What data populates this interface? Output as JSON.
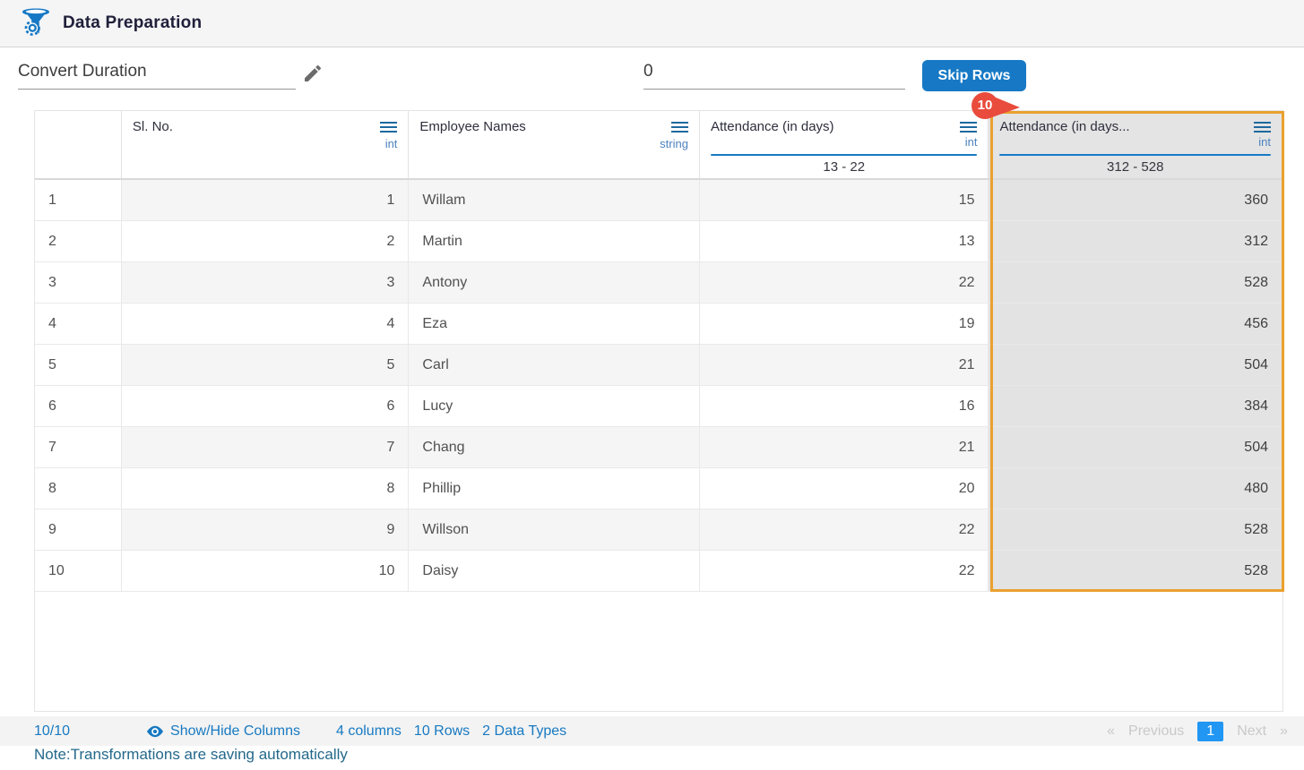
{
  "colors": {
    "accent_blue": "#1779C5",
    "link_blue": "#1779C2",
    "active_page_blue": "#2196F3",
    "highlight_orange": "#EAA12F",
    "badge_red": "#E94B3C",
    "type_label_blue": "#4D82BE",
    "note_teal": "#23688A"
  },
  "header": {
    "title": "Data Preparation",
    "logo_icon": "funnel-gear-icon"
  },
  "toolbar": {
    "transform_name": "Convert Duration",
    "edit_icon": "pencil-icon",
    "skip_rows_value": "0",
    "skip_rows_label": "Skip Rows",
    "column_badge_count": "10"
  },
  "table": {
    "columns": [
      {
        "name": "Sl. No.",
        "type": "int"
      },
      {
        "name": "Employee Names",
        "type": "string"
      },
      {
        "name": "Attendance (in days)",
        "type": "int",
        "range": "13 - 22"
      },
      {
        "name": "Attendance (in days...",
        "type": "int",
        "range": "312 - 528",
        "highlighted": true
      }
    ],
    "rows": [
      {
        "num": "1",
        "sl_no": "1",
        "employee_name": "Willam",
        "attendance1": "15",
        "attendance2": "360"
      },
      {
        "num": "2",
        "sl_no": "2",
        "employee_name": "Martin",
        "attendance1": "13",
        "attendance2": "312"
      },
      {
        "num": "3",
        "sl_no": "3",
        "employee_name": "Antony",
        "attendance1": "22",
        "attendance2": "528"
      },
      {
        "num": "4",
        "sl_no": "4",
        "employee_name": "Eza",
        "attendance1": "19",
        "attendance2": "456"
      },
      {
        "num": "5",
        "sl_no": "5",
        "employee_name": "Carl",
        "attendance1": "21",
        "attendance2": "504"
      },
      {
        "num": "6",
        "sl_no": "6",
        "employee_name": "Lucy",
        "attendance1": "16",
        "attendance2": "384"
      },
      {
        "num": "7",
        "sl_no": "7",
        "employee_name": "Chang",
        "attendance1": "21",
        "attendance2": "504"
      },
      {
        "num": "8",
        "sl_no": "8",
        "employee_name": "Phillip",
        "attendance1": "20",
        "attendance2": "480"
      },
      {
        "num": "9",
        "sl_no": "9",
        "employee_name": "Willson",
        "attendance1": "22",
        "attendance2": "528"
      },
      {
        "num": "10",
        "sl_no": "10",
        "employee_name": "Daisy",
        "attendance1": "22",
        "attendance2": "528"
      }
    ]
  },
  "footer": {
    "visible_count": "10/10",
    "eye_icon": "eye-icon",
    "show_hide_label": "Show/Hide Columns",
    "stats": {
      "columns": "4 columns",
      "rows": "10 Rows",
      "data_types": "2 Data Types"
    },
    "pagination": {
      "first": "«",
      "previous": "Previous",
      "current_page": "1",
      "next": "Next",
      "last": "»"
    }
  },
  "note": "Note:Transformations are saving automatically"
}
